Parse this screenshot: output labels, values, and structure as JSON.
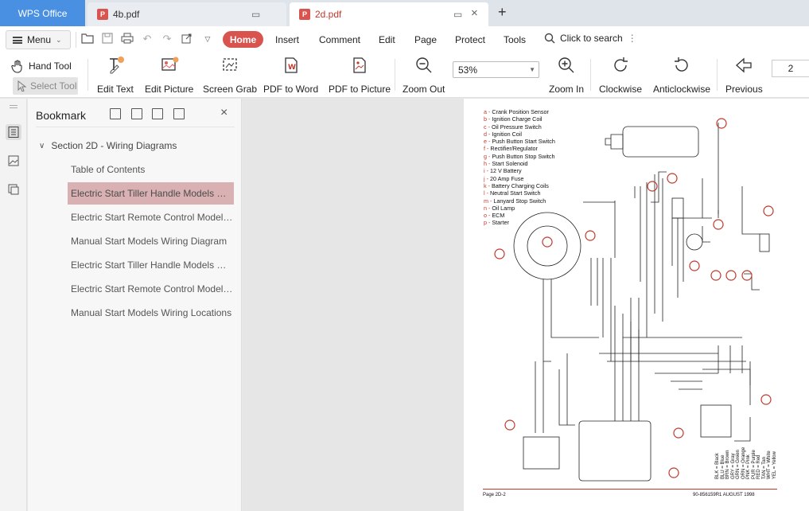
{
  "tabs": {
    "app": "WPS Office",
    "doc1": "4b.pdf",
    "doc2": "2d.pdf"
  },
  "menubar": {
    "menu_label": "Menu",
    "items": [
      "Home",
      "Insert",
      "Comment",
      "Edit",
      "Page",
      "Protect",
      "Tools"
    ],
    "search_label": "Click to search"
  },
  "toolbar": {
    "hand_tool": "Hand Tool",
    "select_tool": "Select Tool",
    "edit_text": "Edit Text",
    "edit_picture": "Edit Picture",
    "screen_grab": "Screen Grab",
    "pdf_to_word": "PDF to Word",
    "pdf_to_picture": "PDF to Picture",
    "zoom_out": "Zoom Out",
    "zoom_value": "53%",
    "zoom_in": "Zoom In",
    "clockwise": "Clockwise",
    "anticlockwise": "Anticlockwise",
    "previous": "Previous",
    "page_number": "2"
  },
  "bookmark": {
    "title": "Bookmark",
    "section": "Section 2D - Wiring Diagrams",
    "items": [
      "Table of Contents",
      "Electric Start Tiller Handle Models Wiring Diagram",
      "Electric Start Remote Control Models Wiring Diagram",
      "Manual Start Models Wiring Diagram",
      "Electric Start Tiller Handle Models Wiring Locations",
      "Electric Start Remote Control Models Wiring Locations",
      "Manual Start Models Wiring Locations"
    ]
  },
  "document": {
    "legend": [
      {
        "k": "a",
        "t": "Crank Position Sensor"
      },
      {
        "k": "b",
        "t": "Ignition Charge Coil"
      },
      {
        "k": "c",
        "t": "Oil Pressure Switch"
      },
      {
        "k": "d",
        "t": "Ignition Coil"
      },
      {
        "k": "e",
        "t": "Push Button Start Switch"
      },
      {
        "k": "f",
        "t": "Rectifier/Regulator"
      },
      {
        "k": "g",
        "t": "Push Button Stop Switch"
      },
      {
        "k": "h",
        "t": "Start Solenoid"
      },
      {
        "k": "i",
        "t": "12 V Battery"
      },
      {
        "k": "j",
        "t": "20 Amp Fuse"
      },
      {
        "k": "k",
        "t": "Battery Charging Coils"
      },
      {
        "k": "l",
        "t": "Neutral Start Switch"
      },
      {
        "k": "m",
        "t": "Lanyard Stop Switch"
      },
      {
        "k": "n",
        "t": "Oil Lamp"
      },
      {
        "k": "o",
        "t": "ECM"
      },
      {
        "k": "p",
        "t": "Starter"
      }
    ],
    "color_key": [
      "BLK = Black",
      "BLU = Blue",
      "BRN = Brown",
      "GRY = Gray",
      "GRN = Green",
      "ORN = Orange",
      "PNK = Pink",
      "PUR = Purple",
      "RED = Red",
      "TAN = Tan",
      "WHT = White",
      "YEL = Yellow"
    ],
    "footer_left": "Page 2D-2",
    "footer_right": "90-856159R1  AUGUST 1998"
  }
}
